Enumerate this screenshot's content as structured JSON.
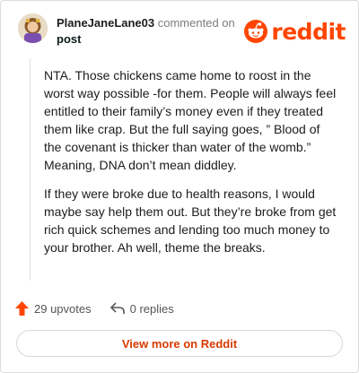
{
  "comment": {
    "author": "PlaneJaneLane03",
    "action_text": "commented on",
    "target": "post",
    "paragraphs": [
      "NTA. Those chickens came home to roost in the worst way possible -for them. People will always feel entitled to their family’s money even if they treated them like crap. But the full saying goes, ” Blood of the covenant is thicker than water of the womb.” Meaning, DNA don’t mean diddley.",
      "If they were broke due to health reasons, I would maybe say help them out. But they’re broke from get rich quick schemes and lending too much money to your brother. Ah well, theme the breaks."
    ]
  },
  "brand": {
    "name": "reddit",
    "color": "#ff4500"
  },
  "actions": {
    "upvotes_label": "29 upvotes",
    "replies_label": "0 replies"
  },
  "cta": {
    "label": "View more on Reddit"
  },
  "icons": {
    "avatar": "avatar",
    "logo": "reddit-logo-icon",
    "upvote": "upvote-arrow-icon",
    "reply": "reply-arrow-icon"
  }
}
